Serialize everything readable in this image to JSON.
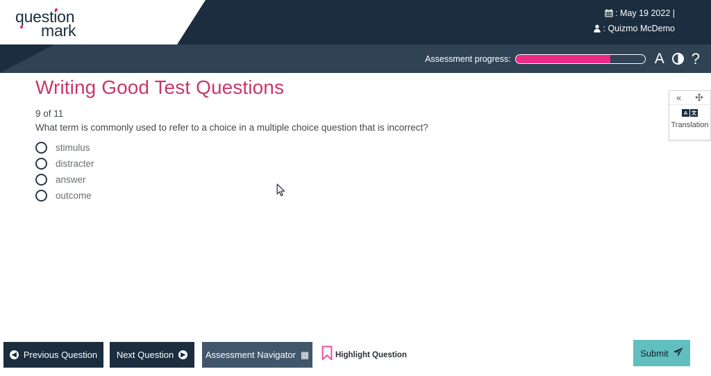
{
  "brand": {
    "logo_line1": "question",
    "logo_line2": "mark",
    "accent_pink": "#e1297e",
    "navy": "#1b2d3e",
    "slate": "#2f4355"
  },
  "header": {
    "date_icon": "calendar-icon",
    "date_text": ": May 19 2022 |",
    "user_icon": "user-icon",
    "user_text": ": Quizmo McDemo"
  },
  "progress": {
    "label": "Assessment progress:",
    "percent": 73,
    "fill_color": "#ec2a85",
    "font_size_icon": "A",
    "contrast_icon": "contrast-icon",
    "help_icon": "?"
  },
  "main": {
    "title": "Writing Good Test Questions",
    "title_color": "#c9376a",
    "question_counter": "9  of 11",
    "question_text": "What term is commonly used to refer to a choice in a multiple choice question that is incorrect?",
    "options": [
      {
        "label": "stimulus",
        "selected": false
      },
      {
        "label": "distracter",
        "selected": false
      },
      {
        "label": "answer",
        "selected": false
      },
      {
        "label": "outcome",
        "selected": false
      }
    ]
  },
  "translation_panel": {
    "collapse_icon": "«",
    "move_icon": "move-icon",
    "chip_left": "A",
    "chip_right": "文",
    "label": "Translation"
  },
  "footer": {
    "previous_label": "Previous Question",
    "previous_icon": "arrow-left-circle-icon",
    "next_label": "Next Question",
    "next_icon": "arrow-right-circle-icon",
    "navigator_label": "Assessment Navigator",
    "navigator_icon": "grid-icon",
    "highlight_label": "Highlight Question",
    "highlight_icon": "bookmark-icon",
    "submit_label": "Submit",
    "submit_icon": "send-icon",
    "submit_color": "#62bfc0"
  }
}
